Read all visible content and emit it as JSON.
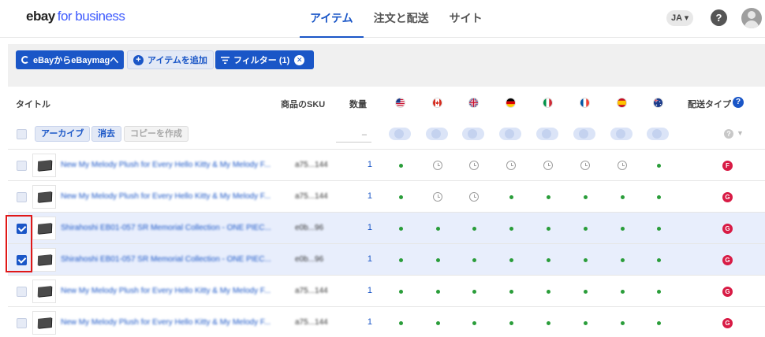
{
  "header": {
    "logo_part1": "ebay",
    "logo_part2": "for business",
    "tabs": [
      {
        "label": "アイテム",
        "active": true
      },
      {
        "label": "注文と配送",
        "active": false
      },
      {
        "label": "サイト",
        "active": false
      }
    ],
    "language": "JA ▾",
    "help": "?"
  },
  "toolbar": {
    "sync_label": "eBayからeBaymagへ",
    "add_item_label": "アイテムを追加",
    "filter_label": "フィルター (1)"
  },
  "table": {
    "headers": {
      "title": "タイトル",
      "sku": "商品のSKU",
      "qty": "数量",
      "shipping": "配送タイプ"
    },
    "flags": [
      "US",
      "CA",
      "UK",
      "DE",
      "IT",
      "FR",
      "ES",
      "AU"
    ],
    "bulk_actions": {
      "archive": "アーカイブ",
      "delete": "消去",
      "copy": "コピーを作成",
      "qty_placeholder": "–"
    },
    "rows": [
      {
        "title": "New My Melody Plush for Every Hello Kitty & My Melody F...",
        "sku": "a75...144",
        "qty": "1",
        "checked": false,
        "status": [
          "dot",
          "clock",
          "clock",
          "clock",
          "clock",
          "clock",
          "clock",
          "dot"
        ],
        "shipping": "F"
      },
      {
        "title": "New My Melody Plush for Every Hello Kitty & My Melody F...",
        "sku": "a75...144",
        "qty": "1",
        "checked": false,
        "status": [
          "dot",
          "clock",
          "clock",
          "dot",
          "dot",
          "dot",
          "dot",
          "dot"
        ],
        "shipping": "G"
      },
      {
        "title": "Shirahoshi EB01-057 SR Memorial Collection - ONE PIEC...",
        "sku": "e0b...96",
        "qty": "1",
        "checked": true,
        "status": [
          "dot",
          "dot",
          "dot",
          "dot",
          "dot",
          "dot",
          "dot",
          "dot"
        ],
        "shipping": "G"
      },
      {
        "title": "Shirahoshi EB01-057 SR Memorial Collection - ONE PIEC...",
        "sku": "e0b...96",
        "qty": "1",
        "checked": true,
        "status": [
          "dot",
          "dot",
          "dot",
          "dot",
          "dot",
          "dot",
          "dot",
          "dot"
        ],
        "shipping": "G"
      },
      {
        "title": "New My Melody Plush for Every Hello Kitty & My Melody F...",
        "sku": "a75...144",
        "qty": "1",
        "checked": false,
        "status": [
          "dot",
          "dot",
          "dot",
          "dot",
          "dot",
          "dot",
          "dot",
          "dot"
        ],
        "shipping": "G"
      },
      {
        "title": "New My Melody Plush for Every Hello Kitty & My Melody F...",
        "sku": "a75...144",
        "qty": "1",
        "checked": false,
        "status": [
          "dot",
          "dot",
          "dot",
          "dot",
          "dot",
          "dot",
          "dot",
          "dot"
        ],
        "shipping": "G"
      }
    ]
  },
  "colors": {
    "accent": "#1a56c7",
    "status_green": "#2a9d3a",
    "badge_red": "#d81b45",
    "selected_row": "#e8eefc",
    "highlight": "#e01818"
  }
}
